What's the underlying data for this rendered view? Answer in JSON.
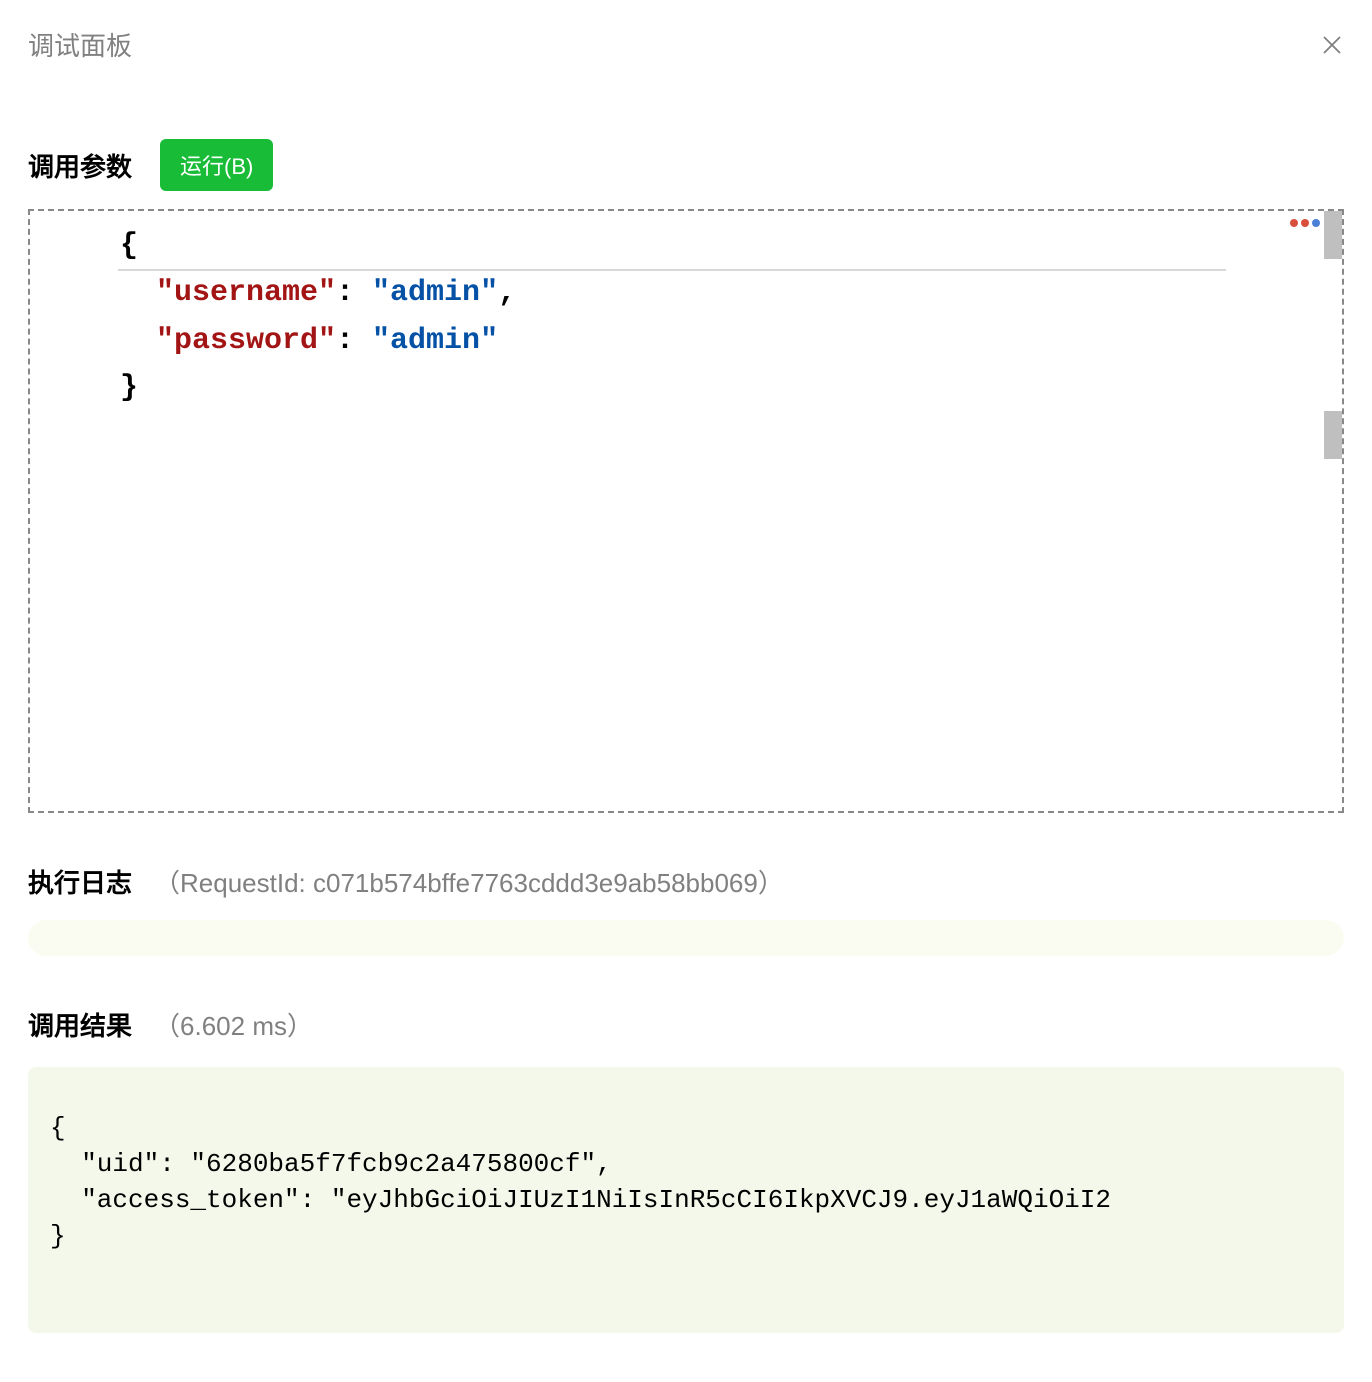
{
  "header": {
    "title": "调试面板"
  },
  "params": {
    "title": "调用参数",
    "run_button": "运行(B)",
    "editor": {
      "open_brace": "{",
      "close_brace": "}",
      "line1_key": "\"username\"",
      "line1_colon": ": ",
      "line1_value": "\"admin\"",
      "line1_comma": ",",
      "line2_key": "\"password\"",
      "line2_colon": ": ",
      "line2_value": "\"admin\""
    }
  },
  "log": {
    "title": "执行日志",
    "meta_open": "（RequestId: ",
    "request_id": "c071b574bffe7763cddd3e9ab58bb069",
    "meta_close": "）"
  },
  "result": {
    "title": "调用结果",
    "meta_open": "（",
    "duration": "6.602 ms",
    "meta_close": "）",
    "output": "{\n  \"uid\": \"6280ba5f7fcb9c2a475800cf\",\n  \"access_token\": \"eyJhbGciOiJIUzI1NiIsInR5cCI6IkpXVCJ9.eyJ1aWQiOiI2\n}"
  }
}
